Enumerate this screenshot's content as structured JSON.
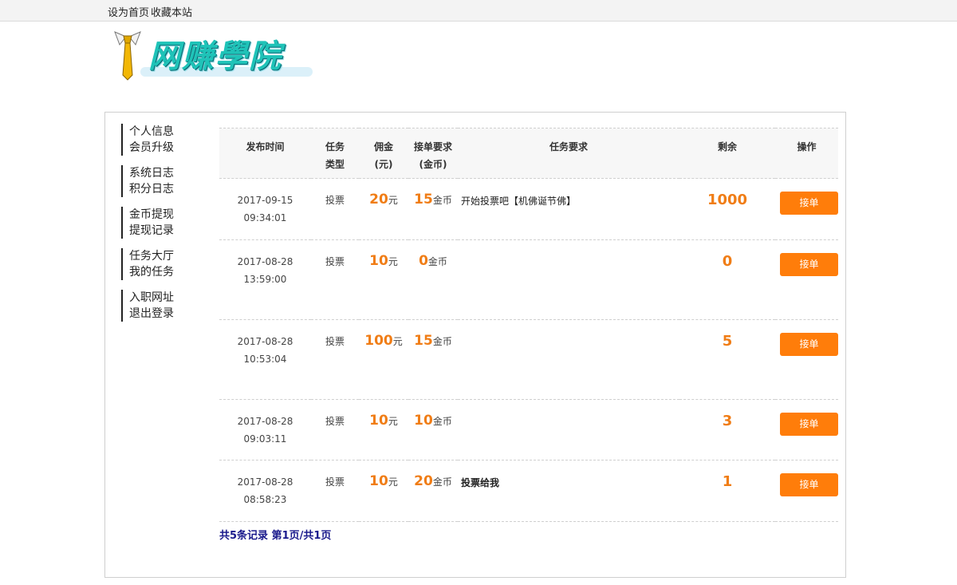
{
  "topbar": {
    "set_home": "设为首页",
    "bookmark": "收藏本站"
  },
  "logo": {
    "text": "网赚學院"
  },
  "sidebar": {
    "groups": [
      [
        "个人信息",
        "会员升级"
      ],
      [
        "系统日志",
        "积分日志"
      ],
      [
        "金币提现",
        "提现记录"
      ],
      [
        "任务大厅",
        "我的任务"
      ],
      [
        "入职网址",
        "退出登录"
      ]
    ]
  },
  "table": {
    "headers": {
      "time": "发布时间",
      "type_1": "任务",
      "type_2": "类型",
      "commission_1": "佣金",
      "commission_2": "(元)",
      "accept_1": "接单要求",
      "accept_2": "(金币)",
      "requirement": "任务要求",
      "remaining": "剩余",
      "action": "操作"
    },
    "yuan_unit": "元",
    "coin_unit": "金币",
    "accept_label": "接单",
    "rows": [
      {
        "date": "2017-09-15",
        "time": "09:34:01",
        "type": "投票",
        "commission": "20",
        "coins": "15",
        "requirement": "开始投票吧【机佛诞节佛】",
        "remaining": "1000"
      },
      {
        "date": "2017-08-28",
        "time": "13:59:00",
        "type": "投票",
        "commission": "10",
        "coins": "0",
        "requirement": "",
        "remaining": "0"
      },
      {
        "date": "2017-08-28",
        "time": "10:53:04",
        "type": "投票",
        "commission": "100",
        "coins": "15",
        "requirement": "",
        "remaining": "5"
      },
      {
        "date": "2017-08-28",
        "time": "09:03:11",
        "type": "投票",
        "commission": "10",
        "coins": "10",
        "requirement": "",
        "remaining": "3"
      },
      {
        "date": "2017-08-28",
        "time": "08:58:23",
        "type": "投票",
        "commission": "10",
        "coins": "20",
        "requirement": "投票给我",
        "remaining": "1"
      }
    ]
  },
  "pager": {
    "text": "共5条记录 第1页/共1页"
  }
}
